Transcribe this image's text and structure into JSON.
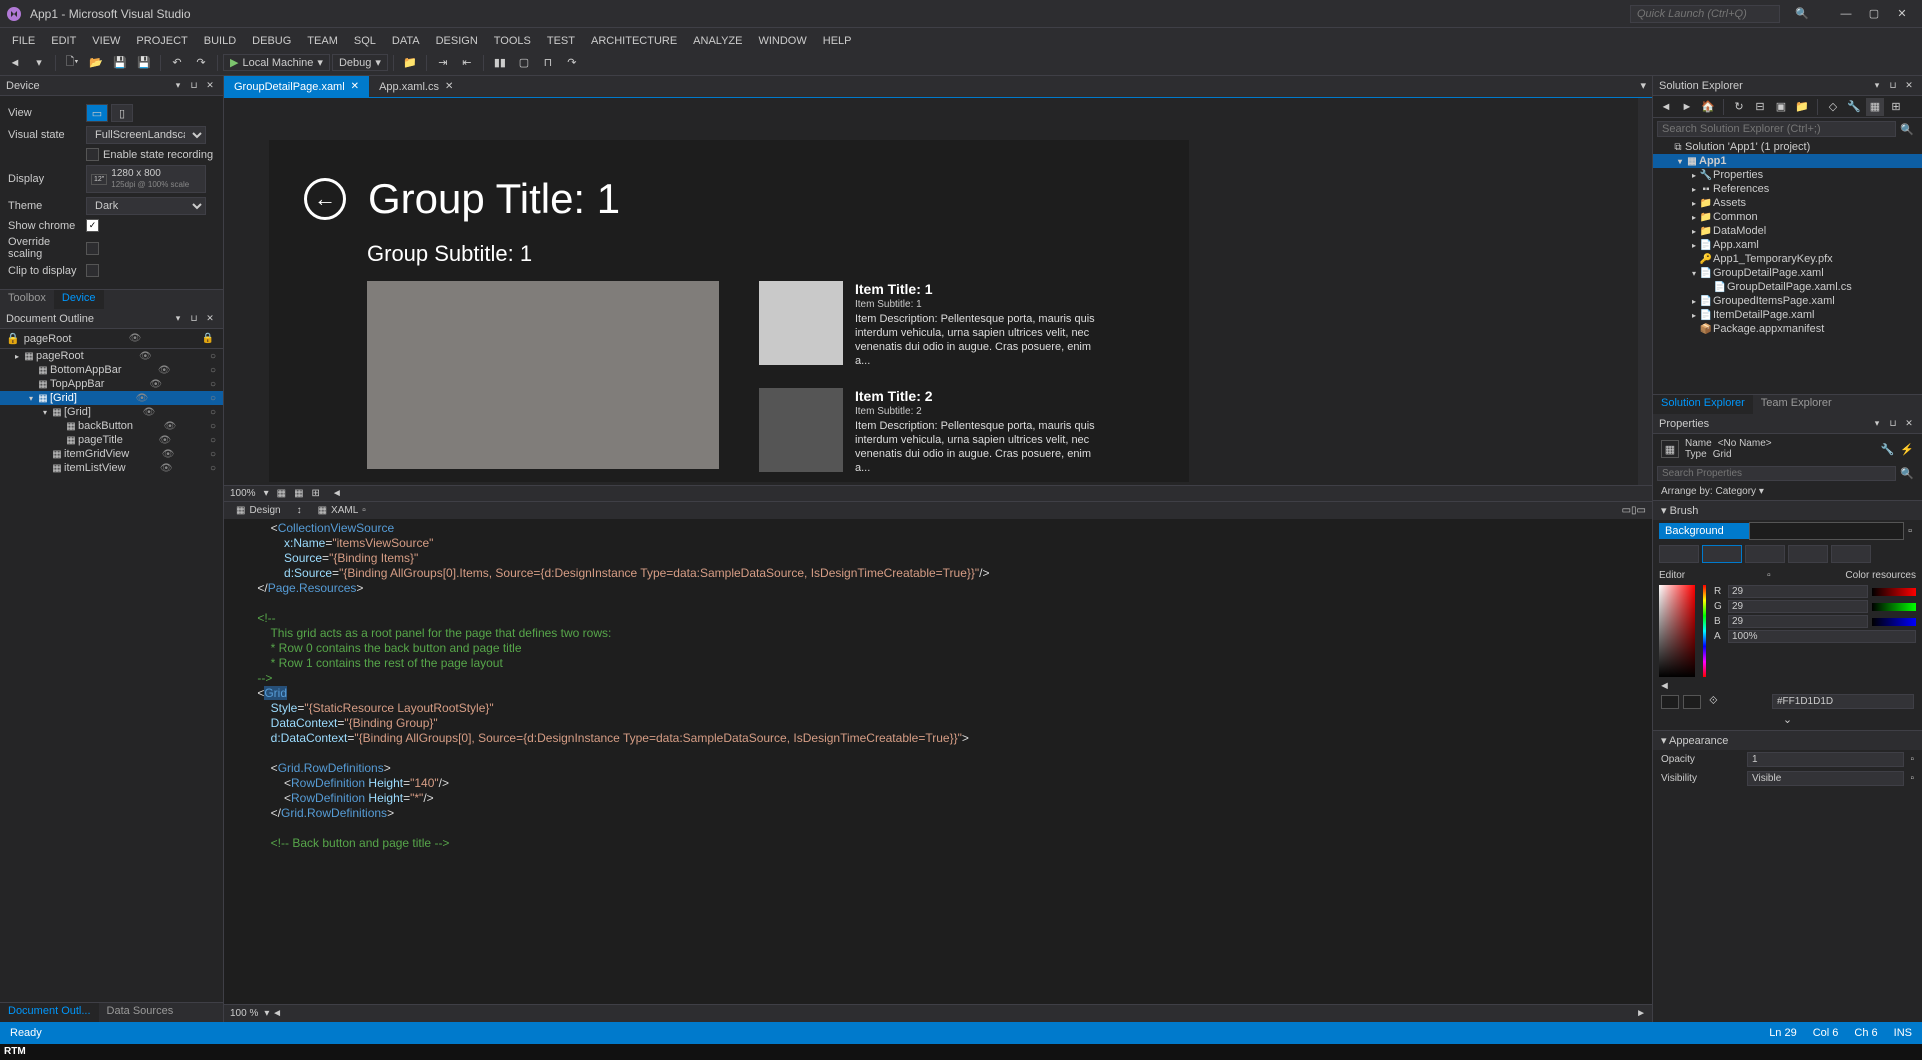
{
  "titlebar": {
    "title": "App1 - Microsoft Visual Studio",
    "quick_launch_placeholder": "Quick Launch (Ctrl+Q)"
  },
  "menu": [
    "FILE",
    "EDIT",
    "VIEW",
    "PROJECT",
    "BUILD",
    "DEBUG",
    "TEAM",
    "SQL",
    "DATA",
    "DESIGN",
    "TOOLS",
    "TEST",
    "ARCHITECTURE",
    "ANALYZE",
    "WINDOW",
    "HELP"
  ],
  "toolbar": {
    "run_label": "Local Machine",
    "config": "Debug"
  },
  "device_panel": {
    "title": "Device",
    "view_label": "View",
    "visual_state_label": "Visual state",
    "visual_state_value": "FullScreenLandscape",
    "enable_recording": "Enable state recording",
    "display_label": "Display",
    "display_size_badge": "12\"",
    "display_res": "1280 x 800",
    "display_dpi": "125dpi @ 100% scale",
    "theme_label": "Theme",
    "theme_value": "Dark",
    "show_chrome": "Show chrome",
    "override_scaling": "Override scaling",
    "clip_to_display": "Clip to display",
    "tabs": [
      "Toolbox",
      "Device"
    ]
  },
  "doc_outline": {
    "title": "Document Outline",
    "root": "pageRoot",
    "tree": [
      {
        "label": "pageRoot",
        "depth": 0,
        "caret": "▸"
      },
      {
        "label": "BottomAppBar",
        "depth": 1,
        "caret": ""
      },
      {
        "label": "TopAppBar",
        "depth": 1,
        "caret": ""
      },
      {
        "label": "[Grid]",
        "depth": 1,
        "caret": "▾",
        "selected": true
      },
      {
        "label": "[Grid]",
        "depth": 2,
        "caret": "▾"
      },
      {
        "label": "backButton",
        "depth": 3,
        "caret": ""
      },
      {
        "label": "pageTitle",
        "depth": 3,
        "caret": ""
      },
      {
        "label": "itemGridView",
        "depth": 2,
        "caret": ""
      },
      {
        "label": "itemListView",
        "depth": 2,
        "caret": ""
      }
    ],
    "bottom_tabs": [
      "Document Outl...",
      "Data Sources"
    ]
  },
  "tabs": [
    {
      "label": "GroupDetailPage.xaml",
      "active": true
    },
    {
      "label": "App.xaml.cs",
      "active": false
    }
  ],
  "designer": {
    "title": "Group Title: 1",
    "subtitle": "Group Subtitle: 1",
    "items": [
      {
        "title": "Item Title: 1",
        "sub": "Item Subtitle: 1",
        "desc": "Item Description: Pellentesque porta, mauris quis interdum vehicula, urna sapien ultrices velit, nec venenatis dui odio in augue. Cras posuere, enim a..."
      },
      {
        "title": "Item Title: 2",
        "sub": "Item Subtitle: 2",
        "desc": "Item Description: Pellentesque porta, mauris quis interdum vehicula, urna sapien ultrices velit, nec venenatis dui odio in augue. Cras posuere, enim a..."
      }
    ],
    "zoom": "100%",
    "view_tabs": {
      "design": "Design",
      "xaml": "XAML"
    }
  },
  "code_status": "100 %",
  "solution": {
    "title": "Solution Explorer",
    "search_placeholder": "Search Solution Explorer (Ctrl+;)",
    "tree": [
      {
        "label": "Solution 'App1' (1 project)",
        "depth": 0,
        "caret": "",
        "icon": "⧉"
      },
      {
        "label": "App1",
        "depth": 1,
        "caret": "▾",
        "icon": "▦",
        "bold": true,
        "selected": true
      },
      {
        "label": "Properties",
        "depth": 2,
        "caret": "▸",
        "icon": "🔧"
      },
      {
        "label": "References",
        "depth": 2,
        "caret": "▸",
        "icon": "▪▪"
      },
      {
        "label": "Assets",
        "depth": 2,
        "caret": "▸",
        "icon": "📁"
      },
      {
        "label": "Common",
        "depth": 2,
        "caret": "▸",
        "icon": "📁"
      },
      {
        "label": "DataModel",
        "depth": 2,
        "caret": "▸",
        "icon": "📁"
      },
      {
        "label": "App.xaml",
        "depth": 2,
        "caret": "▸",
        "icon": "📄"
      },
      {
        "label": "App1_TemporaryKey.pfx",
        "depth": 2,
        "caret": "",
        "icon": "🔑"
      },
      {
        "label": "GroupDetailPage.xaml",
        "depth": 2,
        "caret": "▾",
        "icon": "📄"
      },
      {
        "label": "GroupDetailPage.xaml.cs",
        "depth": 3,
        "caret": "",
        "icon": "📄"
      },
      {
        "label": "GroupedItemsPage.xaml",
        "depth": 2,
        "caret": "▸",
        "icon": "📄"
      },
      {
        "label": "ItemDetailPage.xaml",
        "depth": 2,
        "caret": "▸",
        "icon": "📄"
      },
      {
        "label": "Package.appxmanifest",
        "depth": 2,
        "caret": "",
        "icon": "📦"
      }
    ],
    "bottom_tabs": [
      "Solution Explorer",
      "Team Explorer"
    ]
  },
  "properties": {
    "title": "Properties",
    "name_label": "Name",
    "name_value": "<No Name>",
    "type_label": "Type",
    "type_value": "Grid",
    "search_placeholder": "Search Properties",
    "arrange": "Arrange by: Category ▾",
    "brush_cat": "Brush",
    "brush_prop": "Background",
    "editor_label": "Editor",
    "color_res_label": "Color resources",
    "r": "29",
    "g": "29",
    "b": "29",
    "a": "100%",
    "hex": "#FF1D1D1D",
    "appearance_cat": "Appearance",
    "opacity_label": "Opacity",
    "opacity_val": "1",
    "visibility_label": "Visibility",
    "visibility_val": "Visible"
  },
  "statusbar": {
    "ready": "Ready",
    "line": "Ln 29",
    "col": "Col 6",
    "ch": "Ch 6",
    "ins": "INS"
  },
  "rtm": "RTM"
}
